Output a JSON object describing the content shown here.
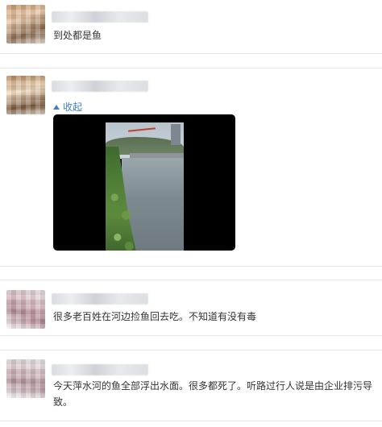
{
  "comments": [
    {
      "text": "到处都是鱼"
    },
    {
      "collapse_label": "收起",
      "media": "video-thumbnail"
    },
    {
      "text": "很多老百姓在河边捡鱼回去吃。不知道有没有毒"
    },
    {
      "text": "今天萍水河的鱼全部浮出水面。很多都死了。听路过行人说是由企业排污导致。"
    }
  ],
  "colors": {
    "link": "#3d7fc1",
    "divider": "#e6e6e6",
    "text": "#333333"
  },
  "icons": {
    "collapse": "caret-up-icon"
  }
}
